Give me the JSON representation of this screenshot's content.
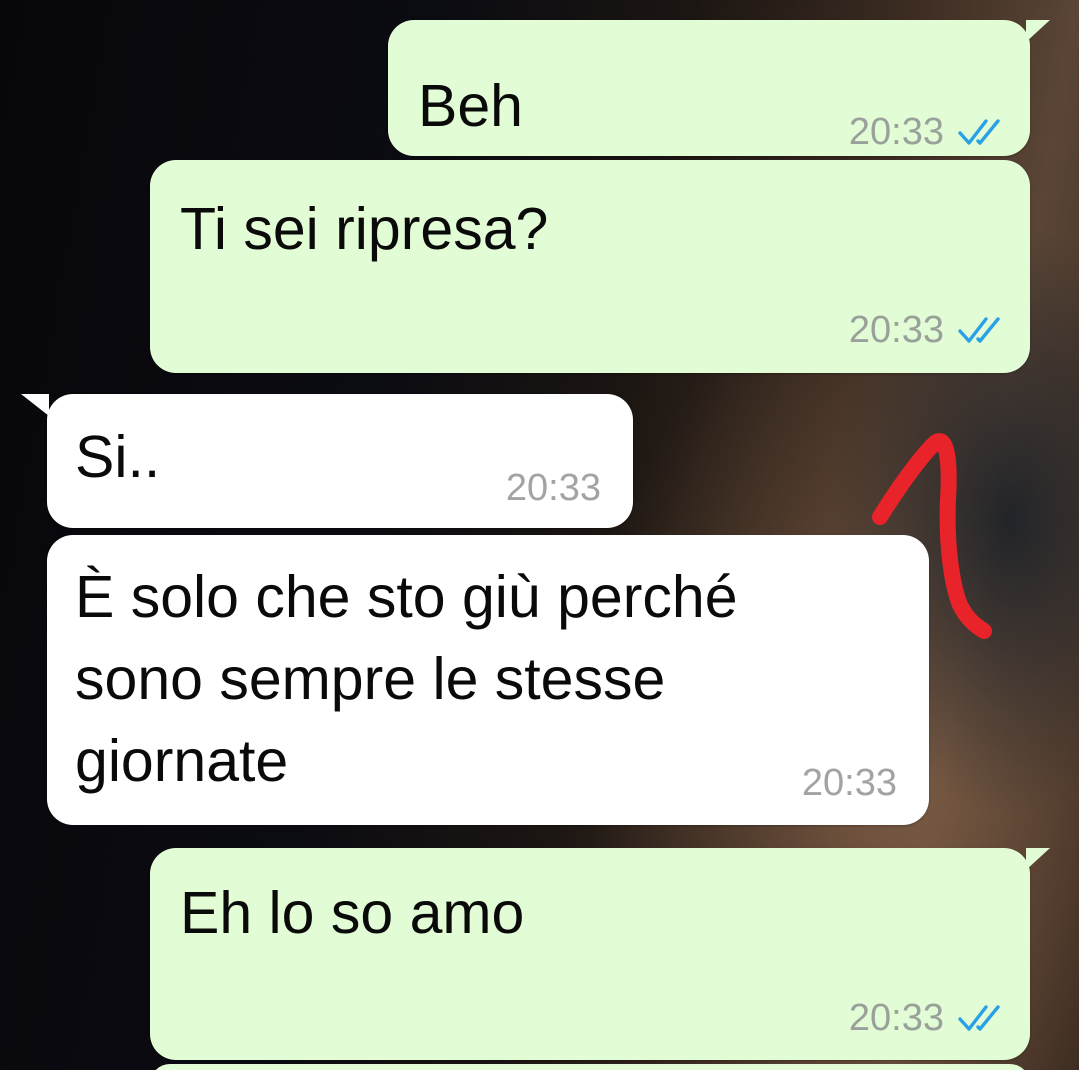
{
  "messages": [
    {
      "direction": "outgoing",
      "text": "Beh",
      "time": "20:33",
      "status": "read-double-check-icon"
    },
    {
      "direction": "outgoing",
      "text": "Ti sei ripresa?",
      "time": "20:33",
      "status": "read-double-check-icon"
    },
    {
      "direction": "incoming",
      "text": "Si..",
      "time": "20:33"
    },
    {
      "direction": "incoming",
      "text": "È solo che sto giù perché\nsono sempre le stesse\ngiornate",
      "time": "20:33"
    },
    {
      "direction": "outgoing",
      "text": "Eh lo so amo",
      "time": "20:33",
      "status": "read-double-check-icon"
    }
  ],
  "colors": {
    "outgoing_bubble": "#e2fdd5",
    "incoming_bubble": "#ffffff",
    "read_ticks": "#2aa0e6",
    "annotation_stroke": "#e8232a"
  }
}
